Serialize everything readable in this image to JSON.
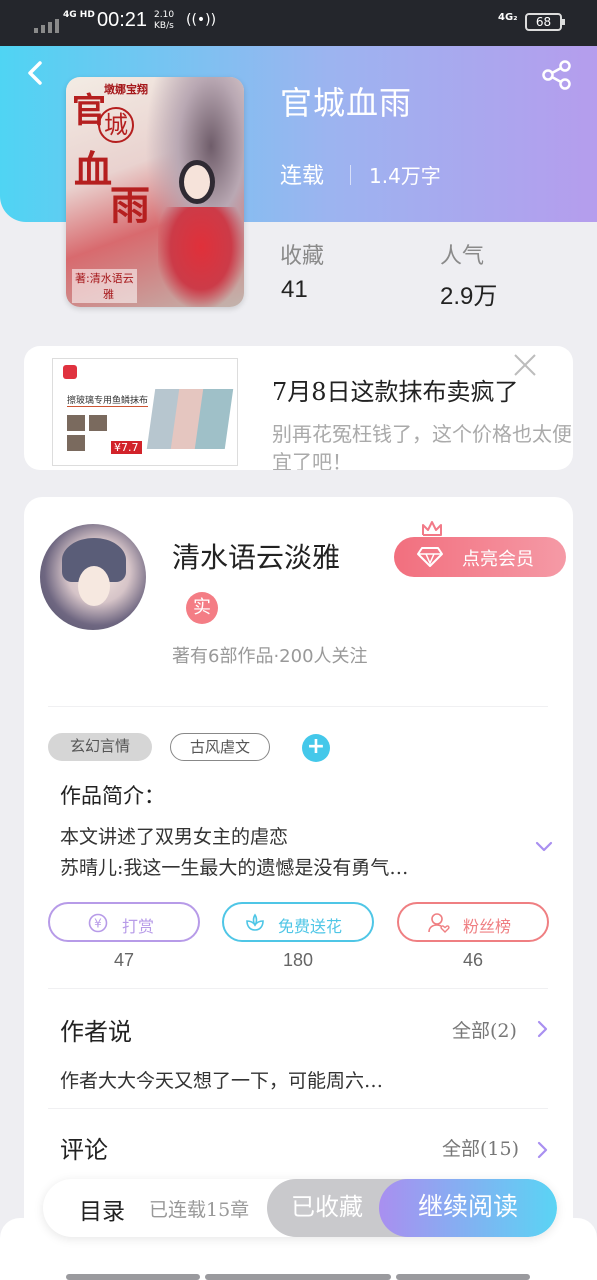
{
  "status_bar": {
    "network": "4G HD",
    "time": "00:21",
    "speed_value": "2.10",
    "speed_unit": "KB/s",
    "network2": "4G₂",
    "battery": "68"
  },
  "book": {
    "title": "官城血雨",
    "status": "连载",
    "word_count": "1.4万字",
    "cover": {
      "series": "墩娜宝翔",
      "title_chars": [
        "官",
        "城",
        "血",
        "雨"
      ],
      "author": "著:清水语云",
      "author_line2": "雅"
    }
  },
  "stats": {
    "favorites_label": "收藏",
    "favorites_value": "41",
    "popularity_label": "人气",
    "popularity_value": "2.9万"
  },
  "ad": {
    "title": "7月8日这款抹布卖疯了",
    "description": "别再花冤枉钱了，这个价格也太便宜了吧！",
    "image": {
      "brand": "擦玻璃专用鱼鳞抹布",
      "price": "¥7.7"
    }
  },
  "author": {
    "name": "清水语云淡雅",
    "vip_label": "点亮会员",
    "badge": "实",
    "meta": "著有6部作品·200人关注"
  },
  "tags": [
    {
      "label": "玄幻言情"
    },
    {
      "label": "古风虐文"
    }
  ],
  "add_tag_symbol": "+",
  "intro": {
    "heading": "作品简介：",
    "line1": "本文讲述了双男女主的虐恋",
    "line2": "苏晴儿:我这一生最大的遗憾是没有勇气…"
  },
  "actions": [
    {
      "label": "打赏",
      "count": "47",
      "color": "#b79be8"
    },
    {
      "label": "免费送花",
      "count": "180",
      "color": "#4fc6e6"
    },
    {
      "label": "粉丝榜",
      "count": "46",
      "color": "#ef7f82"
    }
  ],
  "author_says": {
    "heading": "作者说",
    "more": "全部(2)",
    "text": "作者大大今天又想了一下，可能周六…"
  },
  "comments": {
    "heading": "评论",
    "more": "全部(15)"
  },
  "bottom_bar": {
    "toc": "目录",
    "chapters": "已连载15章",
    "collected": "已收藏",
    "continue": "继续阅读"
  },
  "colors": {
    "header_gradient_start": "#4fd4f3",
    "header_gradient_end": "#b59ded",
    "vip_pink": "#f26f7e",
    "accent_purple": "#a98ff0",
    "accent_cyan": "#5ad4f4"
  },
  "icons": {
    "back": "back-arrow-icon",
    "share": "share-icon",
    "close": "close-icon",
    "crown": "crown-icon",
    "diamond": "diamond-icon",
    "expand": "chevron-down-icon",
    "yen": "yen-coin-icon",
    "flower": "flower-icon",
    "fans": "user-heart-icon",
    "chevron": "chevron-right-icon"
  }
}
